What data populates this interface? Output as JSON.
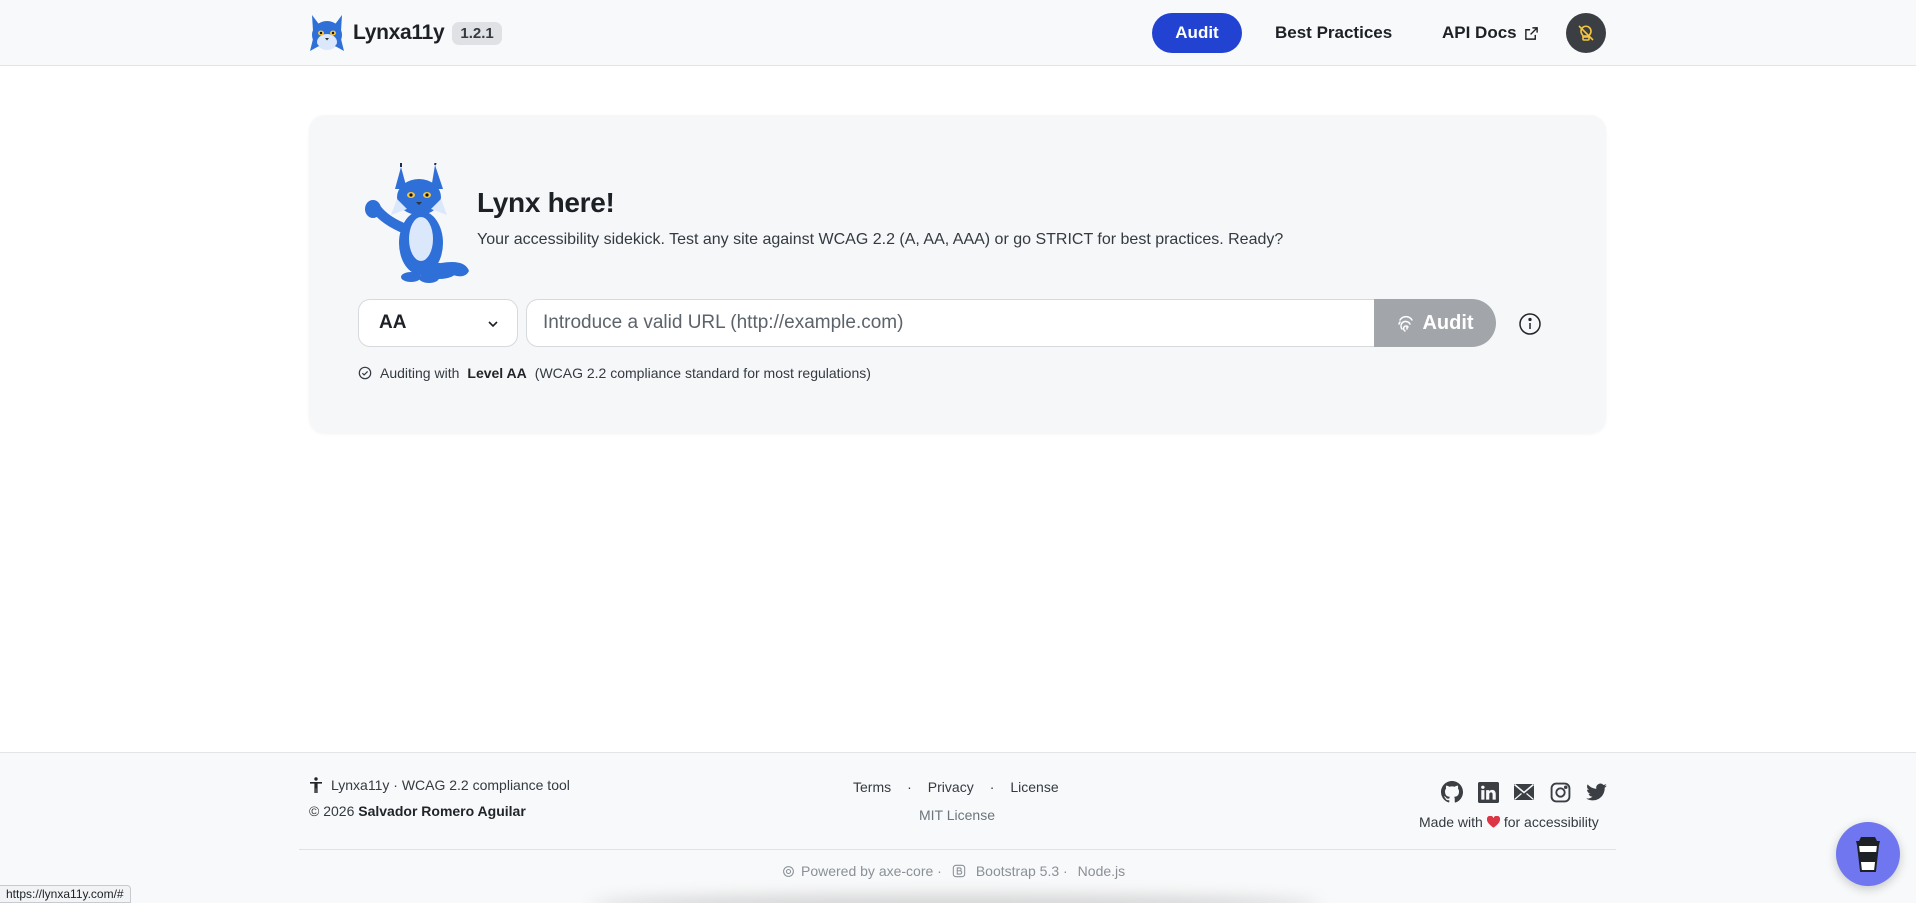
{
  "colors": {
    "primary": "#2243d1",
    "audit_disabled": "#a2a6ab",
    "mascot_blue": "#2f6fd8",
    "heart": "#dc3545",
    "coffee_button": "#6f76ef"
  },
  "navbar": {
    "brand_name": "Lynxa11y",
    "version": "1.2.1",
    "items": [
      {
        "label": "Audit",
        "active": true
      },
      {
        "label": "Best Practices",
        "active": false
      },
      {
        "label": "API Docs",
        "active": false,
        "external": true
      }
    ],
    "theme_toggle_icon": "lightbulb-off-icon"
  },
  "hero": {
    "title": "Lynx here!",
    "subtitle": "Your accessibility sidekick. Test any site against WCAG 2.2 (A, AA, AAA) or go STRICT for best practices. Ready?",
    "level_select": {
      "value": "AA"
    },
    "url_input": {
      "value": "",
      "placeholder": "Introduce a valid URL (http://example.com)"
    },
    "audit_button": "Audit",
    "level_note": {
      "prefix": "Auditing with",
      "level": "Level AA",
      "suffix": "(WCAG 2.2 compliance standard for most regulations)"
    }
  },
  "footer": {
    "tool_line": "Lynxa11y · WCAG 2.2 compliance tool",
    "copyright_prefix": "© 2026",
    "author": "Salvador Romero Aguilar",
    "links": [
      "Terms",
      "Privacy",
      "License"
    ],
    "link_separator": "·",
    "mit": "MIT License",
    "social_icons": [
      "github-icon",
      "linkedin-icon",
      "mail-icon",
      "instagram-icon",
      "twitter-icon"
    ],
    "made_prefix": "Made with",
    "made_suffix": "for accessibility",
    "powered": {
      "axe": "Powered by axe-core ·",
      "bootstrap": "Bootstrap 5.3 ·",
      "node": "Node.js"
    }
  },
  "status_bar": {
    "url": "https://lynxa11y.com/#"
  }
}
